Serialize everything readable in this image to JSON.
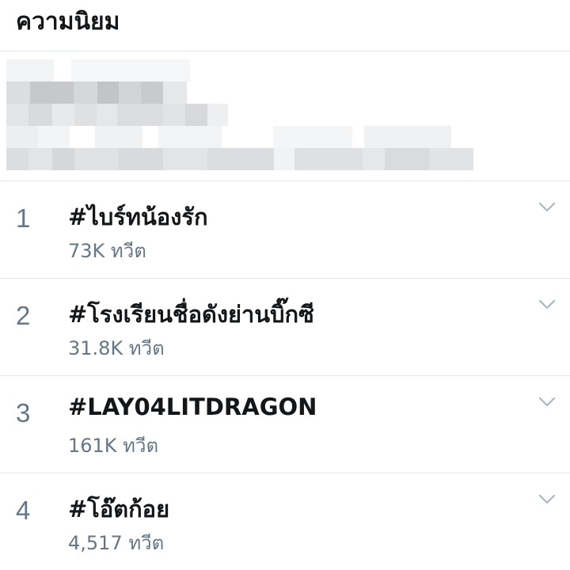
{
  "header": {
    "title": "ความนิยม"
  },
  "trends": [
    {
      "rank": "1",
      "tag": "#ไบร์ทน้องรัก",
      "count": "73K ทวีต",
      "menu_icon": "chevron-down-icon"
    },
    {
      "rank": "2",
      "tag": "#โรงเรียนชื่อดังย่านบิ๊กซี",
      "count": "31.8K ทวีต",
      "menu_icon": "chevron-down-icon"
    },
    {
      "rank": "3",
      "tag": "#LAY04LITDRAGON",
      "count": "161K ทวีต",
      "menu_icon": "chevron-down-icon"
    },
    {
      "rank": "4",
      "tag": "#โอ๊ตก้อย",
      "count": "4,517 ทวีต",
      "menu_icon": "chevron-down-icon"
    }
  ],
  "colors": {
    "primary_text": "#14171a",
    "secondary_text": "#657786",
    "divider": "#e1e8ed",
    "chevron": "#aab8c2"
  }
}
